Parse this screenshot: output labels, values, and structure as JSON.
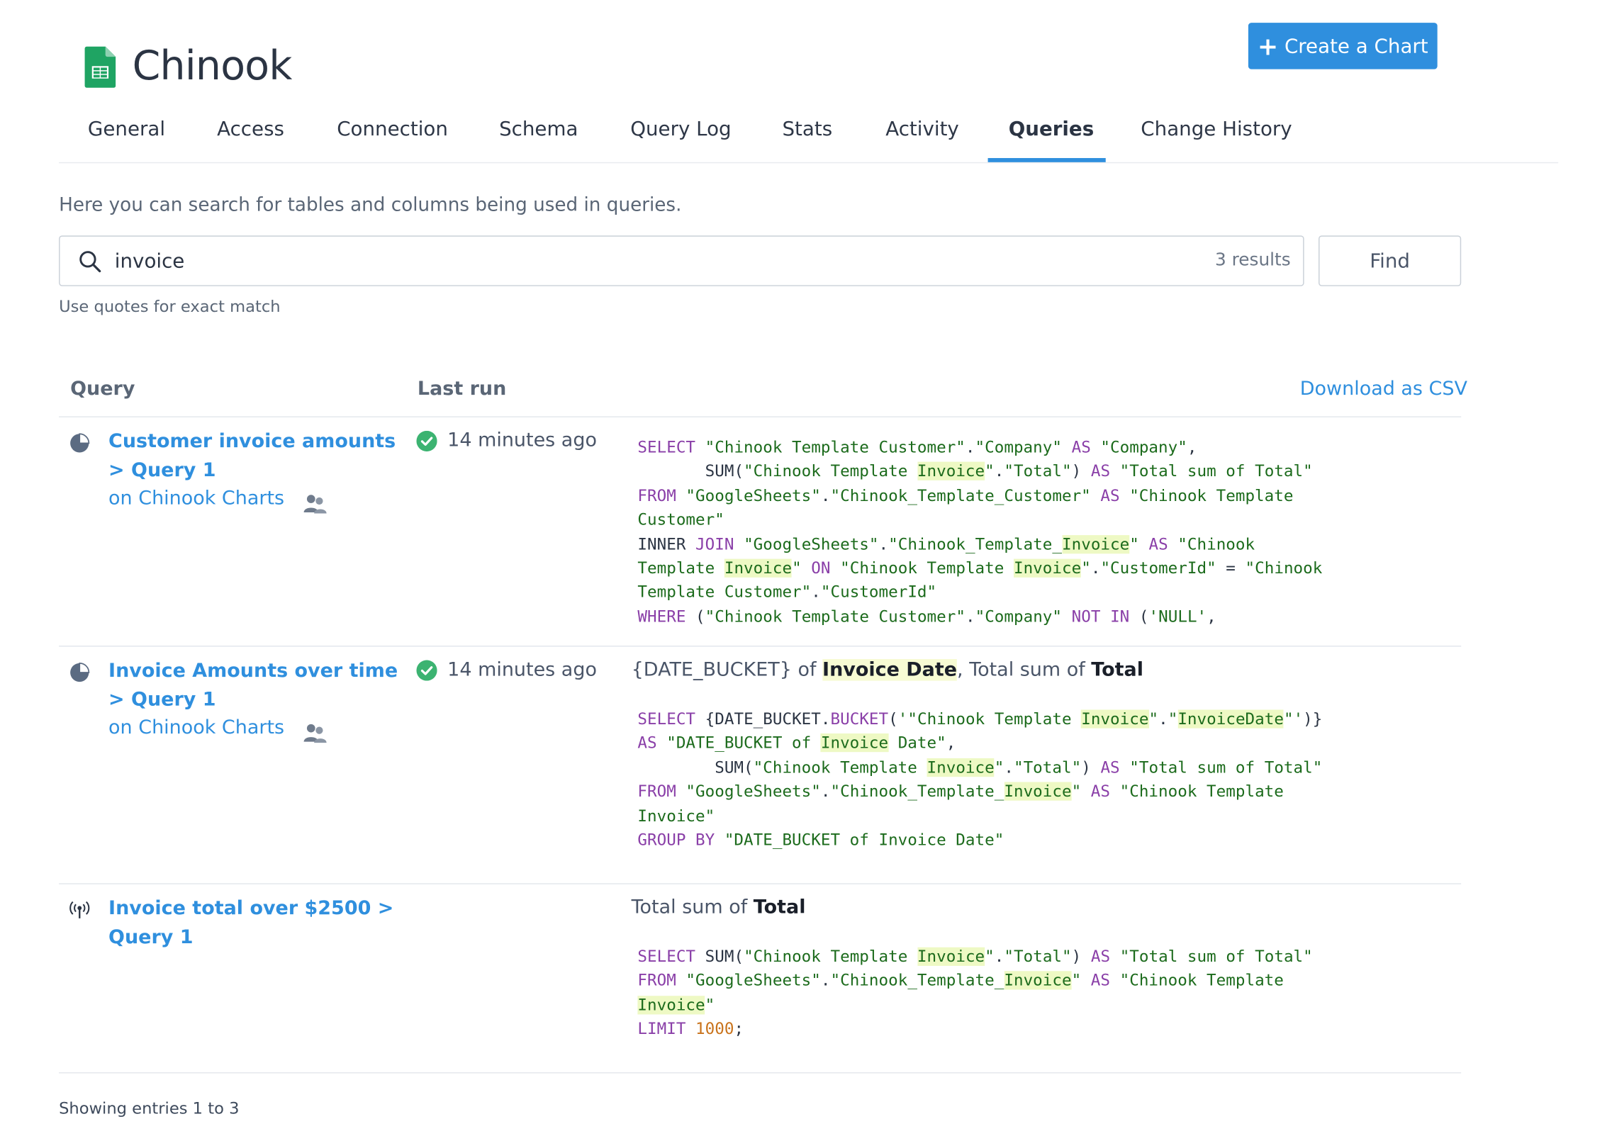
{
  "header": {
    "title": "Chinook",
    "create_chart_label": "Create a Chart"
  },
  "tabs": [
    "General",
    "Access",
    "Connection",
    "Schema",
    "Query Log",
    "Stats",
    "Activity",
    "Queries",
    "Change History"
  ],
  "active_tab": "Queries",
  "intro": "Here you can search for tables and columns being used in queries.",
  "search": {
    "value": "invoice",
    "results": "3 results",
    "find_label": "Find",
    "hint": "Use quotes for exact match"
  },
  "table": {
    "col_query": "Query",
    "col_last_run": "Last run",
    "download_label": "Download as CSV",
    "rows": [
      {
        "icon": "pie-chart-icon",
        "name_line1": "Customer invoice amounts",
        "name_line2": "> Query 1",
        "on_word": "on",
        "dashboard": "Chinook Charts",
        "last_run": "14 minutes ago"
      },
      {
        "icon": "pie-chart-icon",
        "name_line1": "Invoice Amounts over time",
        "name_line2": "> Query 1",
        "on_word": "on",
        "dashboard": "Chinook Charts",
        "last_run": "14 minutes ago",
        "summary": {
          "pre": "{DATE_BUCKET} of ",
          "bold1": "Invoice Date",
          "mid": ", Total sum of ",
          "bold2": "Total"
        }
      },
      {
        "icon": "broadcast-icon",
        "name_line1": "Invoice total over $2500 >",
        "name_line2": "Query 1",
        "summary": {
          "pre": "Total sum of ",
          "bold": "Total"
        }
      }
    ]
  },
  "footer": "Showing entries 1 to 3",
  "colors": {
    "accent": "#2f8fde",
    "keyword": "#8a3fa8",
    "string": "#1c6b1c",
    "number": "#c9731c",
    "highlight": "#eef9c4",
    "success": "#3cb371"
  }
}
